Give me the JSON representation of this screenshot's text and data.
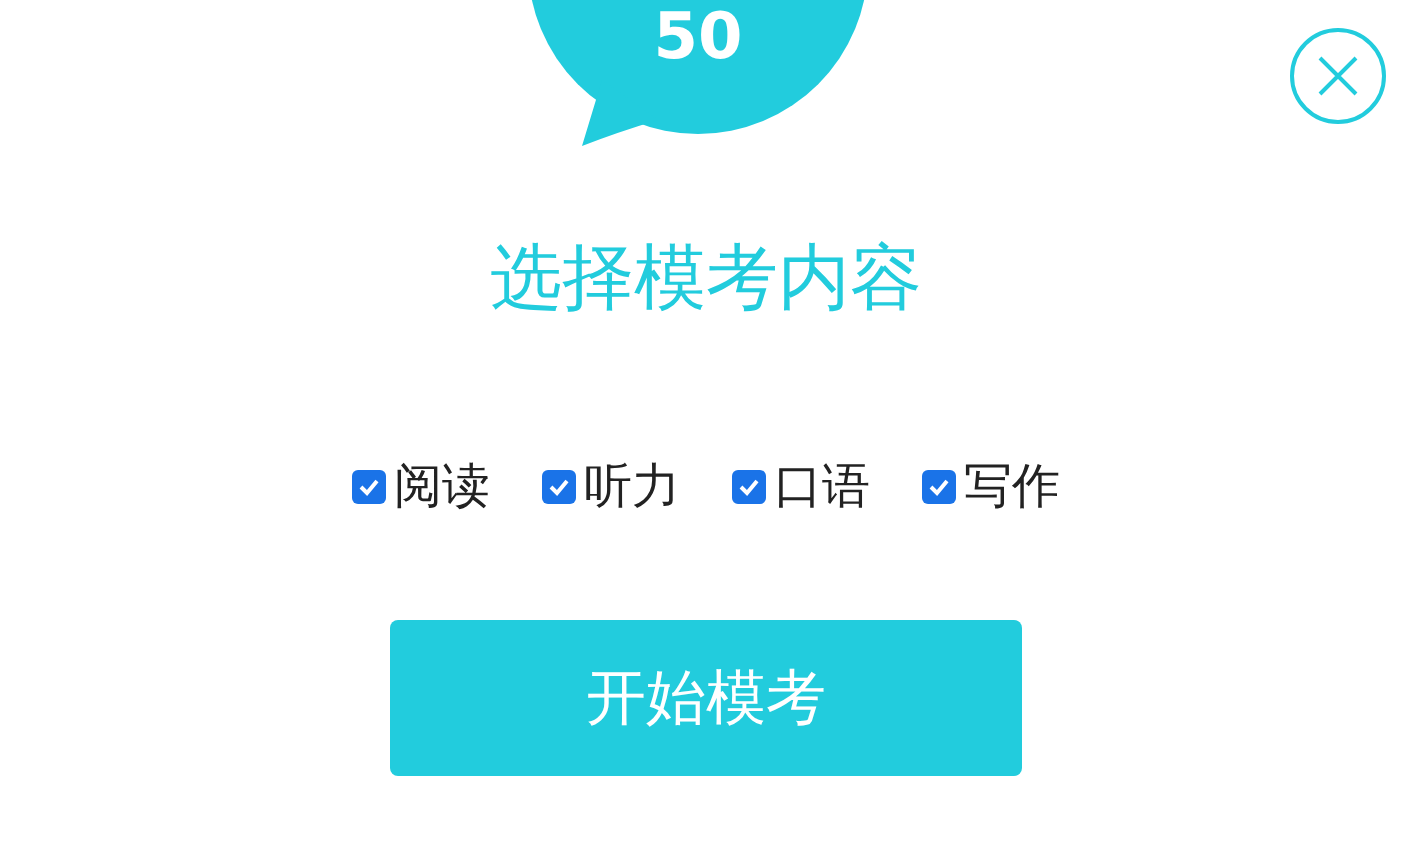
{
  "badge": {
    "text": "50"
  },
  "title": "选择模考内容",
  "options": [
    {
      "label": "阅读",
      "checked": true
    },
    {
      "label": "听力",
      "checked": true
    },
    {
      "label": "口语",
      "checked": true
    },
    {
      "label": "写作",
      "checked": true
    }
  ],
  "start_button": "开始模考"
}
